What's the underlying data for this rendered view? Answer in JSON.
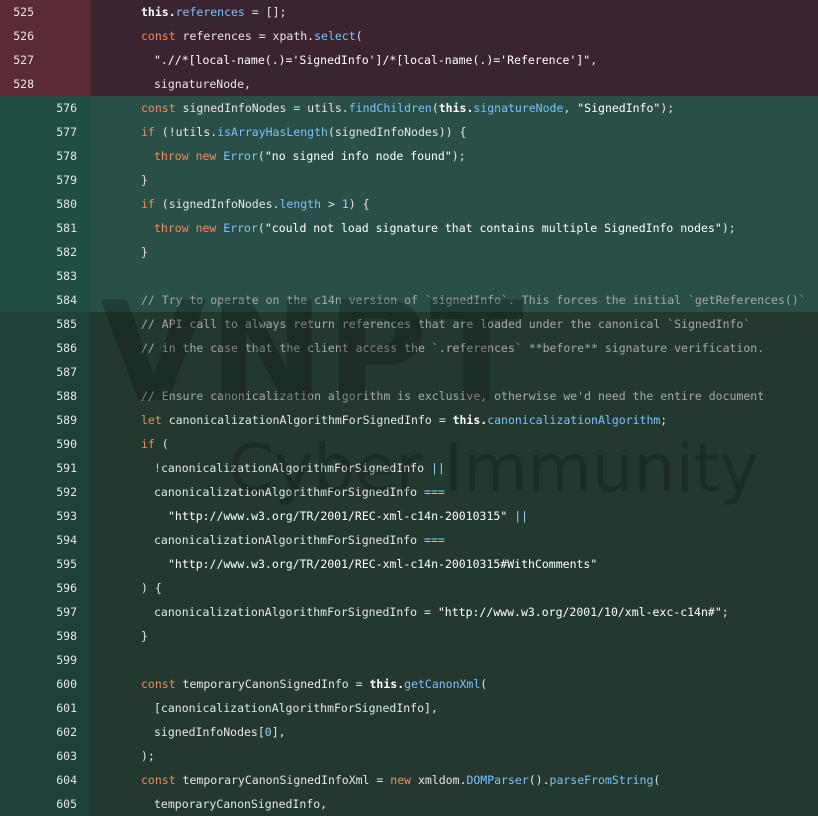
{
  "watermark": {
    "brand": "VNPT",
    "subtitle": "Cyber Immunity"
  },
  "rows": [
    {
      "type": "del",
      "old": "525",
      "new": "",
      "indent": 2,
      "tokens": [
        [
          "this.",
          "this"
        ],
        [
          "references",
          "prop"
        ],
        [
          " = [];",
          ""
        ]
      ]
    },
    {
      "type": "del",
      "old": "526",
      "new": "",
      "indent": 2,
      "tokens": [
        [
          "const",
          "kw"
        ],
        [
          " references = xpath.",
          ""
        ],
        [
          "select",
          "fn"
        ],
        [
          "(",
          ""
        ]
      ]
    },
    {
      "type": "del",
      "old": "527",
      "new": "",
      "indent": 3,
      "tokens": [
        [
          "\".//*[local-name(.)='SignedInfo']/*[local-name(.)='Reference']\"",
          "str"
        ],
        [
          ",",
          ""
        ]
      ]
    },
    {
      "type": "del",
      "old": "528",
      "new": "",
      "indent": 3,
      "tokens": [
        [
          "signatureNode,",
          ""
        ]
      ]
    },
    {
      "type": "add",
      "old": "",
      "new": "576",
      "indent": 2,
      "tokens": [
        [
          "const",
          "kw"
        ],
        [
          " signedInfoNodes = utils.",
          ""
        ],
        [
          "findChildren",
          "fn"
        ],
        [
          "(",
          ""
        ],
        [
          "this.",
          "this"
        ],
        [
          "signatureNode",
          "prop"
        ],
        [
          ", ",
          ""
        ],
        [
          "\"SignedInfo\"",
          "str"
        ],
        [
          ");",
          ""
        ]
      ]
    },
    {
      "type": "add",
      "old": "",
      "new": "577",
      "indent": 2,
      "tokens": [
        [
          "if",
          "kw"
        ],
        [
          " (!utils.",
          ""
        ],
        [
          "isArrayHasLength",
          "fn"
        ],
        [
          "(signedInfoNodes)) {",
          ""
        ]
      ]
    },
    {
      "type": "add",
      "old": "",
      "new": "578",
      "indent": 3,
      "tokens": [
        [
          "throw",
          "kw"
        ],
        [
          " ",
          ""
        ],
        [
          "new",
          "kw"
        ],
        [
          " ",
          ""
        ],
        [
          "Error",
          "cls"
        ],
        [
          "(",
          ""
        ],
        [
          "\"no signed info node found\"",
          "str"
        ],
        [
          ");",
          ""
        ]
      ]
    },
    {
      "type": "add",
      "old": "",
      "new": "579",
      "indent": 2,
      "tokens": [
        [
          "}",
          ""
        ]
      ]
    },
    {
      "type": "add",
      "old": "",
      "new": "580",
      "indent": 2,
      "tokens": [
        [
          "if",
          "kw"
        ],
        [
          " (signedInfoNodes.",
          ""
        ],
        [
          "length",
          "prop"
        ],
        [
          " > ",
          ""
        ],
        [
          "1",
          "num"
        ],
        [
          ") {",
          ""
        ]
      ]
    },
    {
      "type": "add",
      "old": "",
      "new": "581",
      "indent": 3,
      "tokens": [
        [
          "throw",
          "kw"
        ],
        [
          " ",
          ""
        ],
        [
          "new",
          "kw"
        ],
        [
          " ",
          ""
        ],
        [
          "Error",
          "cls"
        ],
        [
          "(",
          ""
        ],
        [
          "\"could not load signature that contains multiple SignedInfo nodes\"",
          "str"
        ],
        [
          ");",
          ""
        ]
      ]
    },
    {
      "type": "add",
      "old": "",
      "new": "582",
      "indent": 2,
      "tokens": [
        [
          "}",
          ""
        ]
      ]
    },
    {
      "type": "add",
      "old": "",
      "new": "583",
      "indent": 0,
      "tokens": []
    },
    {
      "type": "add",
      "old": "",
      "new": "584",
      "indent": 2,
      "tokens": [
        [
          "// Try to operate on the c14n version of `signedInfo`. This forces the initial `getReferences()`",
          "cmt"
        ]
      ]
    },
    {
      "type": "ctx",
      "old": "",
      "new": "585",
      "indent": 2,
      "tokens": [
        [
          "// API call to always return references that are loaded under the canonical `SignedInfo`",
          "cmt"
        ]
      ]
    },
    {
      "type": "ctx",
      "old": "",
      "new": "586",
      "indent": 2,
      "tokens": [
        [
          "// in the case that the client access the `.references` **before** signature verification.",
          "cmt"
        ]
      ]
    },
    {
      "type": "ctx",
      "old": "",
      "new": "587",
      "indent": 0,
      "tokens": []
    },
    {
      "type": "ctx",
      "old": "",
      "new": "588",
      "indent": 2,
      "tokens": [
        [
          "// Ensure canonicalization algorithm is exclusive, otherwise we'd need the entire document",
          "cmt"
        ]
      ]
    },
    {
      "type": "ctx",
      "old": "",
      "new": "589",
      "indent": 2,
      "tokens": [
        [
          "let",
          "kw"
        ],
        [
          " canonicalizationAlgorithmForSignedInfo = ",
          ""
        ],
        [
          "this.",
          "this"
        ],
        [
          "canonicalizationAlgorithm",
          "prop"
        ],
        [
          ";",
          ""
        ]
      ]
    },
    {
      "type": "ctx",
      "old": "",
      "new": "590",
      "indent": 2,
      "tokens": [
        [
          "if",
          "kw"
        ],
        [
          " (",
          ""
        ]
      ]
    },
    {
      "type": "ctx",
      "old": "",
      "new": "591",
      "indent": 3,
      "tokens": [
        [
          "!",
          "op"
        ],
        [
          "canonicalizationAlgorithmForSignedInfo ",
          ""
        ],
        [
          "||",
          "op"
        ]
      ]
    },
    {
      "type": "ctx",
      "old": "",
      "new": "592",
      "indent": 3,
      "tokens": [
        [
          "canonicalizationAlgorithmForSignedInfo ",
          ""
        ],
        [
          "===",
          "op"
        ]
      ]
    },
    {
      "type": "ctx",
      "old": "",
      "new": "593",
      "indent": 4,
      "tokens": [
        [
          "\"http://www.w3.org/TR/2001/REC-xml-c14n-20010315\"",
          "str"
        ],
        [
          " ",
          ""
        ],
        [
          "||",
          "op"
        ]
      ]
    },
    {
      "type": "ctx",
      "old": "",
      "new": "594",
      "indent": 3,
      "tokens": [
        [
          "canonicalizationAlgorithmForSignedInfo ",
          ""
        ],
        [
          "===",
          "op"
        ]
      ]
    },
    {
      "type": "ctx",
      "old": "",
      "new": "595",
      "indent": 4,
      "tokens": [
        [
          "\"http://www.w3.org/TR/2001/REC-xml-c14n-20010315#WithComments\"",
          "str"
        ]
      ]
    },
    {
      "type": "ctx",
      "old": "",
      "new": "596",
      "indent": 2,
      "tokens": [
        [
          ") {",
          ""
        ]
      ]
    },
    {
      "type": "ctx",
      "old": "",
      "new": "597",
      "indent": 3,
      "tokens": [
        [
          "canonicalizationAlgorithmForSignedInfo = ",
          ""
        ],
        [
          "\"http://www.w3.org/2001/10/xml-exc-c14n#\"",
          "str"
        ],
        [
          ";",
          ""
        ]
      ]
    },
    {
      "type": "ctx",
      "old": "",
      "new": "598",
      "indent": 2,
      "tokens": [
        [
          "}",
          ""
        ]
      ]
    },
    {
      "type": "ctx",
      "old": "",
      "new": "599",
      "indent": 0,
      "tokens": []
    },
    {
      "type": "ctx",
      "old": "",
      "new": "600",
      "indent": 2,
      "tokens": [
        [
          "const",
          "kw"
        ],
        [
          " temporaryCanonSignedInfo = ",
          ""
        ],
        [
          "this.",
          "this"
        ],
        [
          "getCanonXml",
          "fn"
        ],
        [
          "(",
          ""
        ]
      ]
    },
    {
      "type": "ctx",
      "old": "",
      "new": "601",
      "indent": 3,
      "tokens": [
        [
          "[canonicalizationAlgorithmForSignedInfo],",
          ""
        ]
      ]
    },
    {
      "type": "ctx",
      "old": "",
      "new": "602",
      "indent": 3,
      "tokens": [
        [
          "signedInfoNodes[",
          ""
        ],
        [
          "0",
          "num"
        ],
        [
          "],",
          ""
        ]
      ]
    },
    {
      "type": "ctx",
      "old": "",
      "new": "603",
      "indent": 2,
      "tokens": [
        [
          ");",
          ""
        ]
      ]
    },
    {
      "type": "ctx",
      "old": "",
      "new": "604",
      "indent": 2,
      "tokens": [
        [
          "const",
          "kw"
        ],
        [
          " temporaryCanonSignedInfoXml = ",
          ""
        ],
        [
          "new",
          "kw"
        ],
        [
          " xmldom.",
          ""
        ],
        [
          "DOMParser",
          "cls"
        ],
        [
          "().",
          ""
        ],
        [
          "parseFromString",
          "fn"
        ],
        [
          "(",
          ""
        ]
      ]
    },
    {
      "type": "ctx",
      "old": "",
      "new": "605",
      "indent": 3,
      "tokens": [
        [
          "temporaryCanonSignedInfo,",
          ""
        ]
      ]
    }
  ]
}
